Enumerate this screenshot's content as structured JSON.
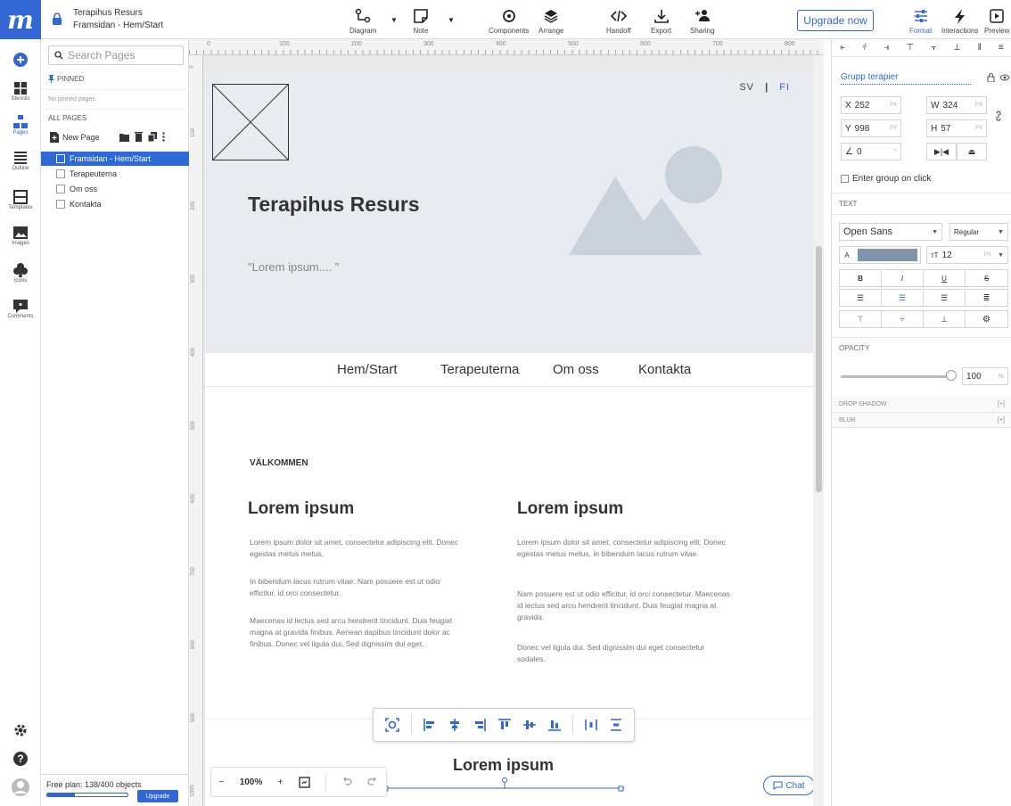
{
  "app": {
    "project_name": "Terapihus Resurs",
    "page_path": "Framsidan - Hem/Start"
  },
  "toolbar": {
    "diagram": "Diagram",
    "note": "Note",
    "components": "Components",
    "arrange": "Arrange",
    "handoff": "Handoff",
    "export": "Export",
    "sharing": "Sharing",
    "upgrade": "Upgrade now",
    "format": "Format",
    "interactions": "Interactions",
    "preview": "Preview"
  },
  "rail": {
    "stencils": "Stencils",
    "pages": "Pages",
    "outline": "Outline",
    "templates": "Templates",
    "images": "Images",
    "icons": "Icons",
    "comments": "Comments"
  },
  "pages_panel": {
    "search_placeholder": "Search Pages",
    "pinned_label": "PINNED",
    "no_pinned": "No pinned pages",
    "all_pages_label": "ALL PAGES",
    "new_page": "New Page",
    "pages": [
      {
        "name": "Framsidan - Hem/Start",
        "selected": true
      },
      {
        "name": "Terapeuterna",
        "selected": false
      },
      {
        "name": "Om oss",
        "selected": false
      },
      {
        "name": "Kontakta",
        "selected": false
      }
    ],
    "plan_text": "Free plan: 138/400 objects",
    "plan_progress": 0.345,
    "upgrade": "Upgrade"
  },
  "rulers": {
    "h_ticks": [
      "0",
      "100",
      "200",
      "300",
      "400",
      "500",
      "600",
      "700",
      "800"
    ],
    "v_ticks": [
      "0",
      "100",
      "200",
      "300",
      "400",
      "500",
      "600",
      "700",
      "800",
      "900",
      "1000"
    ]
  },
  "canvas": {
    "lang_sv": "SV",
    "lang_sep": "|",
    "lang_fi": "FI",
    "hero_title": "Terapihus Resurs",
    "hero_quote": "\"Lorem ipsum.... \"",
    "nav": [
      "Hem/Start",
      "Terapeuterna",
      "Om oss",
      "Kontakta"
    ],
    "welcome": "VÄLKOMMEN",
    "col1": {
      "heading": "Lorem ipsum",
      "p1": " Lorem ipsum dolor sit amet, consectetur adipiscing elit. Donec egestas metus metus,",
      "p2": "In bibendum lacus rutrum vitae.  Nam posuere est ut odio efficitur, id orci consectetur.",
      "p3": "Maecenas id lectus sed arcu hendrerit tincidunt. Duis feugiat magna at gravida finibus. Aenean dapibus tincidunt dolor ac finibus. Donec vel ligula dui. Sed dignissim dui eget."
    },
    "col2": {
      "heading": "Lorem ipsum",
      "p1": "Lorem ipsum dolor sit amet, consectetur adipiscing elit. Donec egestas metus metus, in bibendum lacus rutrum vitae.",
      "p2": "Nam posuere est ut odio efficitur, id orci consectetur. Maecenas id lectus sed arcu hendrerit tincidunt. Duis feugiat magna at gravida.",
      "p3": "Donec vel ligula dui. Sed dignissim dui eget consectetur sodales."
    },
    "section2_heading": "Lorem ipsum",
    "zoom": "100%",
    "chat": "Chat"
  },
  "props": {
    "group_name": "Grupp terapier",
    "x": "252",
    "y": "998",
    "w": "324",
    "h": "57",
    "px": "PX",
    "angle": "0",
    "enter_group": "Enter group on click",
    "text_label": "TEXT",
    "font": "Open Sans",
    "weight": "Regular",
    "color_label": "A",
    "font_size": "12",
    "text_color": "#8294ac",
    "bold": "B",
    "italic": "I",
    "underline": "U",
    "strike": "S",
    "opacity_label": "OPACITY",
    "opacity": "100",
    "percent": "%",
    "drop_shadow": "DROP SHADOW",
    "blur": "BLUR",
    "plus": "[+]"
  },
  "colors": {
    "brand": "#3367d6",
    "selection": "#2d6ad8"
  }
}
